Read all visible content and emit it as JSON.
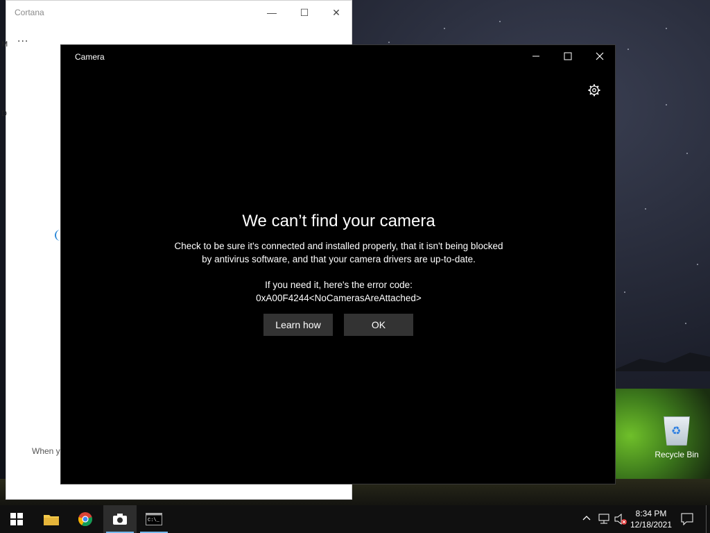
{
  "cortana": {
    "title": "Cortana",
    "more_label": "...",
    "bottom_text": "When y",
    "left_fragment_1": "M",
    "left_fragment_2": "D"
  },
  "camera": {
    "title": "Camera",
    "headline": "We can’t find your camera",
    "message_line1": "Check to be sure it's connected and installed properly, that it isn't being blocked",
    "message_line2": "by antivirus software, and that your camera drivers are up-to-date.",
    "error_intro": "If you need it, here's the error code:",
    "error_code": "0xA00F4244<NoCamerasAreAttached>",
    "learn_how_label": "Learn how",
    "ok_label": "OK"
  },
  "desktop": {
    "recycle_bin_label": "Recycle Bin"
  },
  "taskbar": {
    "time": "8:34 PM",
    "date": "12/18/2021"
  },
  "colors": {
    "camera_bg": "#000000",
    "button_bg": "#333333",
    "taskbar_bg": "#101010",
    "accent": "#76b9ed"
  }
}
